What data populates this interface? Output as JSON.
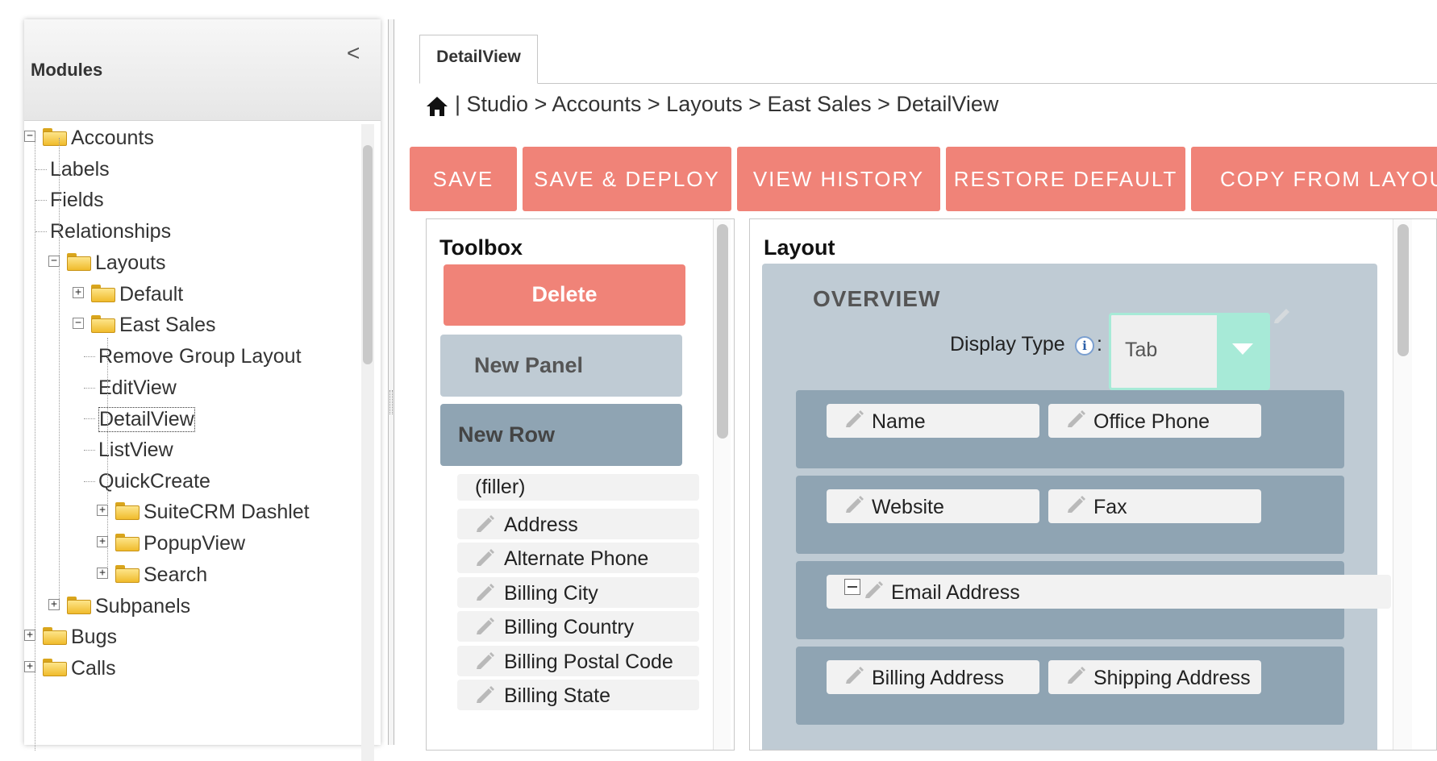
{
  "modules": {
    "title": "Modules",
    "collapse_glyph": "<",
    "tree": [
      {
        "label": "Accounts",
        "level": 0,
        "toggle": "minus",
        "folder": true
      },
      {
        "label": "Labels",
        "level": 1
      },
      {
        "label": "Fields",
        "level": 1
      },
      {
        "label": "Relationships",
        "level": 1
      },
      {
        "label": "Layouts",
        "level": 1,
        "toggle": "minus",
        "folder": true
      },
      {
        "label": "Default",
        "level": 2,
        "toggle": "plus",
        "folder": true
      },
      {
        "label": "East Sales",
        "level": 2,
        "toggle": "minus",
        "folder": true
      },
      {
        "label": "Remove Group Layout",
        "level": 3
      },
      {
        "label": "EditView",
        "level": 3
      },
      {
        "label": "DetailView",
        "level": 3,
        "selected": true
      },
      {
        "label": "ListView",
        "level": 3
      },
      {
        "label": "QuickCreate",
        "level": 3
      },
      {
        "label": "SuiteCRM Dashlet",
        "level": 3,
        "toggle": "plus",
        "folder": true
      },
      {
        "label": "PopupView",
        "level": 3,
        "toggle": "plus",
        "folder": true
      },
      {
        "label": "Search",
        "level": 3,
        "toggle": "plus",
        "folder": true
      },
      {
        "label": "Subpanels",
        "level": 1,
        "toggle": "plus",
        "folder": true
      },
      {
        "label": "Bugs",
        "level": 0,
        "toggle": "plus",
        "folder": true
      },
      {
        "label": "Calls",
        "level": 0,
        "toggle": "plus",
        "folder": true
      }
    ]
  },
  "tab": {
    "label": "DetailView"
  },
  "breadcrumb": {
    "text": "| Studio > Accounts > Layouts > East Sales > DetailView"
  },
  "actions": [
    "SAVE",
    "SAVE & DEPLOY",
    "VIEW HISTORY",
    "RESTORE DEFAULT",
    "COPY FROM LAYOUT"
  ],
  "toolbox": {
    "title": "Toolbox",
    "delete_label": "Delete",
    "new_panel_label": "New Panel",
    "new_row_label": "New Row",
    "items": [
      "(filler)",
      "Address",
      "Alternate Phone",
      "Billing City",
      "Billing Country",
      "Billing Postal Code",
      "Billing State"
    ]
  },
  "layout": {
    "title": "Layout",
    "panel_label": "OVERVIEW",
    "display_type_label": "Display Type",
    "info_glyph": "i",
    "colon": ":",
    "display_type_value": "Tab",
    "rows": [
      [
        "Name",
        "Office Phone"
      ],
      [
        "Website",
        "Fax"
      ],
      [
        "Email Address"
      ],
      [
        "Billing Address",
        "Shipping Address"
      ]
    ]
  },
  "colors": {
    "accent": "#f08378",
    "panel": "#bfcbd4",
    "row": "#8fa4b3",
    "select_border": "#a7ead7"
  }
}
